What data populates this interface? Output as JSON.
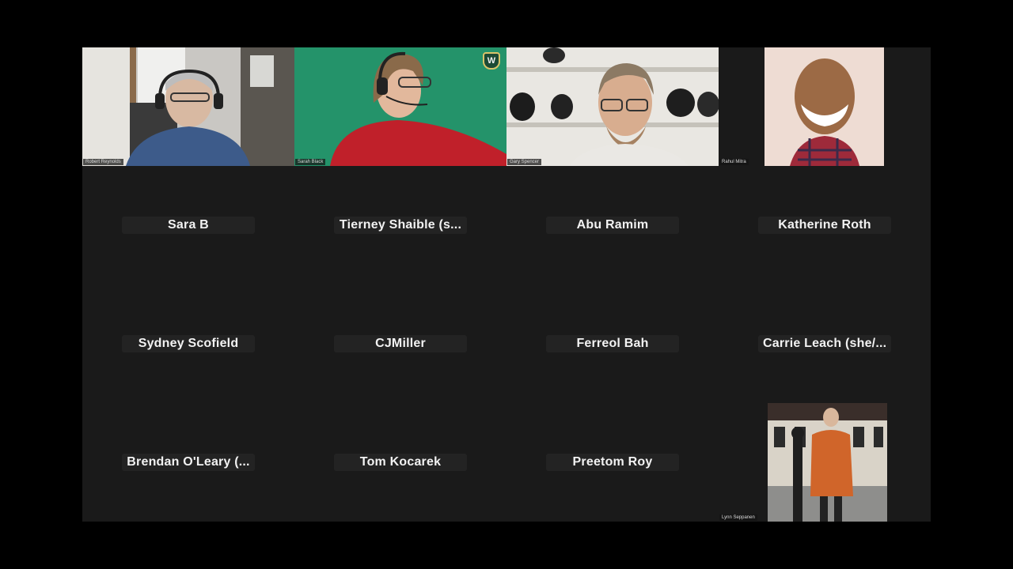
{
  "participants": [
    {
      "name": "Robert Reynolds",
      "video": true
    },
    {
      "name": "Sarah Black",
      "video": true
    },
    {
      "name": "Gary Spencer",
      "video": true
    },
    {
      "name": "Rahul Mitra",
      "video": true
    },
    {
      "name": "Sara B",
      "video": false
    },
    {
      "name": "Tierney Shaible (s...",
      "video": false
    },
    {
      "name": "Abu Ramim",
      "video": false
    },
    {
      "name": "Katherine Roth",
      "video": false
    },
    {
      "name": "Sydney Scofield",
      "video": false
    },
    {
      "name": "CJMiller",
      "video": false
    },
    {
      "name": "Ferreol Bah",
      "video": false
    },
    {
      "name": "Carrie Leach (she/...",
      "video": false
    },
    {
      "name": "Brendan O'Leary (...",
      "video": false
    },
    {
      "name": "Tom Kocarek",
      "video": false
    },
    {
      "name": "Preetom Roy",
      "video": false
    },
    {
      "name": "Lynn Seppanen",
      "video": true
    }
  ],
  "colors": {
    "gallery_bg": "#1a1a1a",
    "name_pill_bg": "#232323",
    "name_text": "#f2f2f2",
    "frame_bg": "#000000"
  },
  "icons": {
    "badge": "shield-w-logo-icon"
  }
}
